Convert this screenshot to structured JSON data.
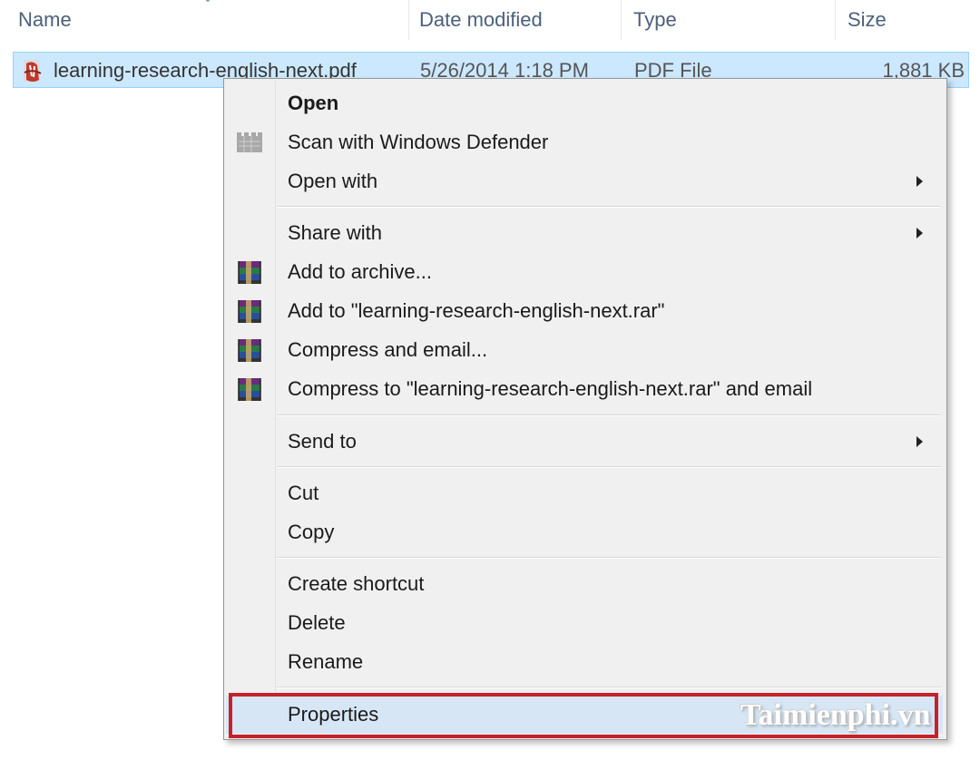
{
  "columns": {
    "name": "Name",
    "date_modified": "Date modified",
    "type": "Type",
    "size": "Size"
  },
  "file": {
    "name": "learning-research-english-next.pdf",
    "date_modified": "5/26/2014 1:18 PM",
    "type": "PDF File",
    "size": "1,881 KB",
    "icon": "pdf-file-icon"
  },
  "menu": {
    "items": [
      {
        "label": "Open",
        "bold": true
      },
      {
        "label": "Scan with Windows Defender",
        "icon": "windows-defender-icon"
      },
      {
        "label": "Open with",
        "submenu": true
      },
      {
        "label": "Share with",
        "submenu": true
      },
      {
        "label": "Add to archive...",
        "icon": "winrar-icon"
      },
      {
        "label": "Add to \"learning-research-english-next.rar\"",
        "icon": "winrar-icon"
      },
      {
        "label": "Compress and email...",
        "icon": "winrar-icon"
      },
      {
        "label": "Compress to \"learning-research-english-next.rar\" and email",
        "icon": "winrar-icon"
      },
      {
        "label": "Send to",
        "submenu": true
      },
      {
        "label": "Cut"
      },
      {
        "label": "Copy"
      },
      {
        "label": "Create shortcut"
      },
      {
        "label": "Delete"
      },
      {
        "label": "Rename"
      },
      {
        "label": "Properties",
        "highlighted": true
      }
    ]
  },
  "watermark": "Taimienphi.vn",
  "colors": {
    "selection": "#cce8ff",
    "highlight_border": "#c4222b",
    "menu_background": "#f0f0f0"
  }
}
